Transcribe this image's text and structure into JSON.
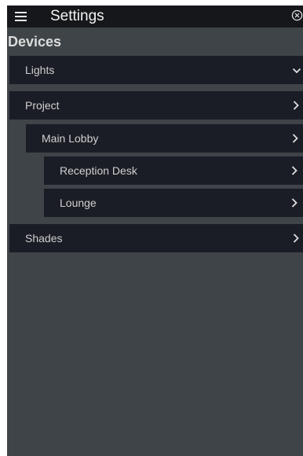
{
  "header": {
    "title": "Settings",
    "menu_icon": "hamburger-icon",
    "close_icon": "close-circle-icon"
  },
  "section": {
    "title": "Devices"
  },
  "devices": {
    "lights": {
      "label": "Lights",
      "icon": "chevron-down-icon"
    },
    "project": {
      "label": "Project",
      "icon": "chevron-right-icon"
    },
    "main_lobby": {
      "label": "Main Lobby",
      "icon": "chevron-right-icon"
    },
    "reception_desk": {
      "label": "Reception Desk",
      "icon": "chevron-right-icon"
    },
    "lounge": {
      "label": "Lounge",
      "icon": "chevron-right-icon"
    },
    "shades": {
      "label": "Shades",
      "icon": "chevron-right-icon"
    }
  },
  "colors": {
    "background": "#3f4448",
    "topbar": "#16171b",
    "row": "#1b1d26",
    "text": "#d0d0d0"
  }
}
